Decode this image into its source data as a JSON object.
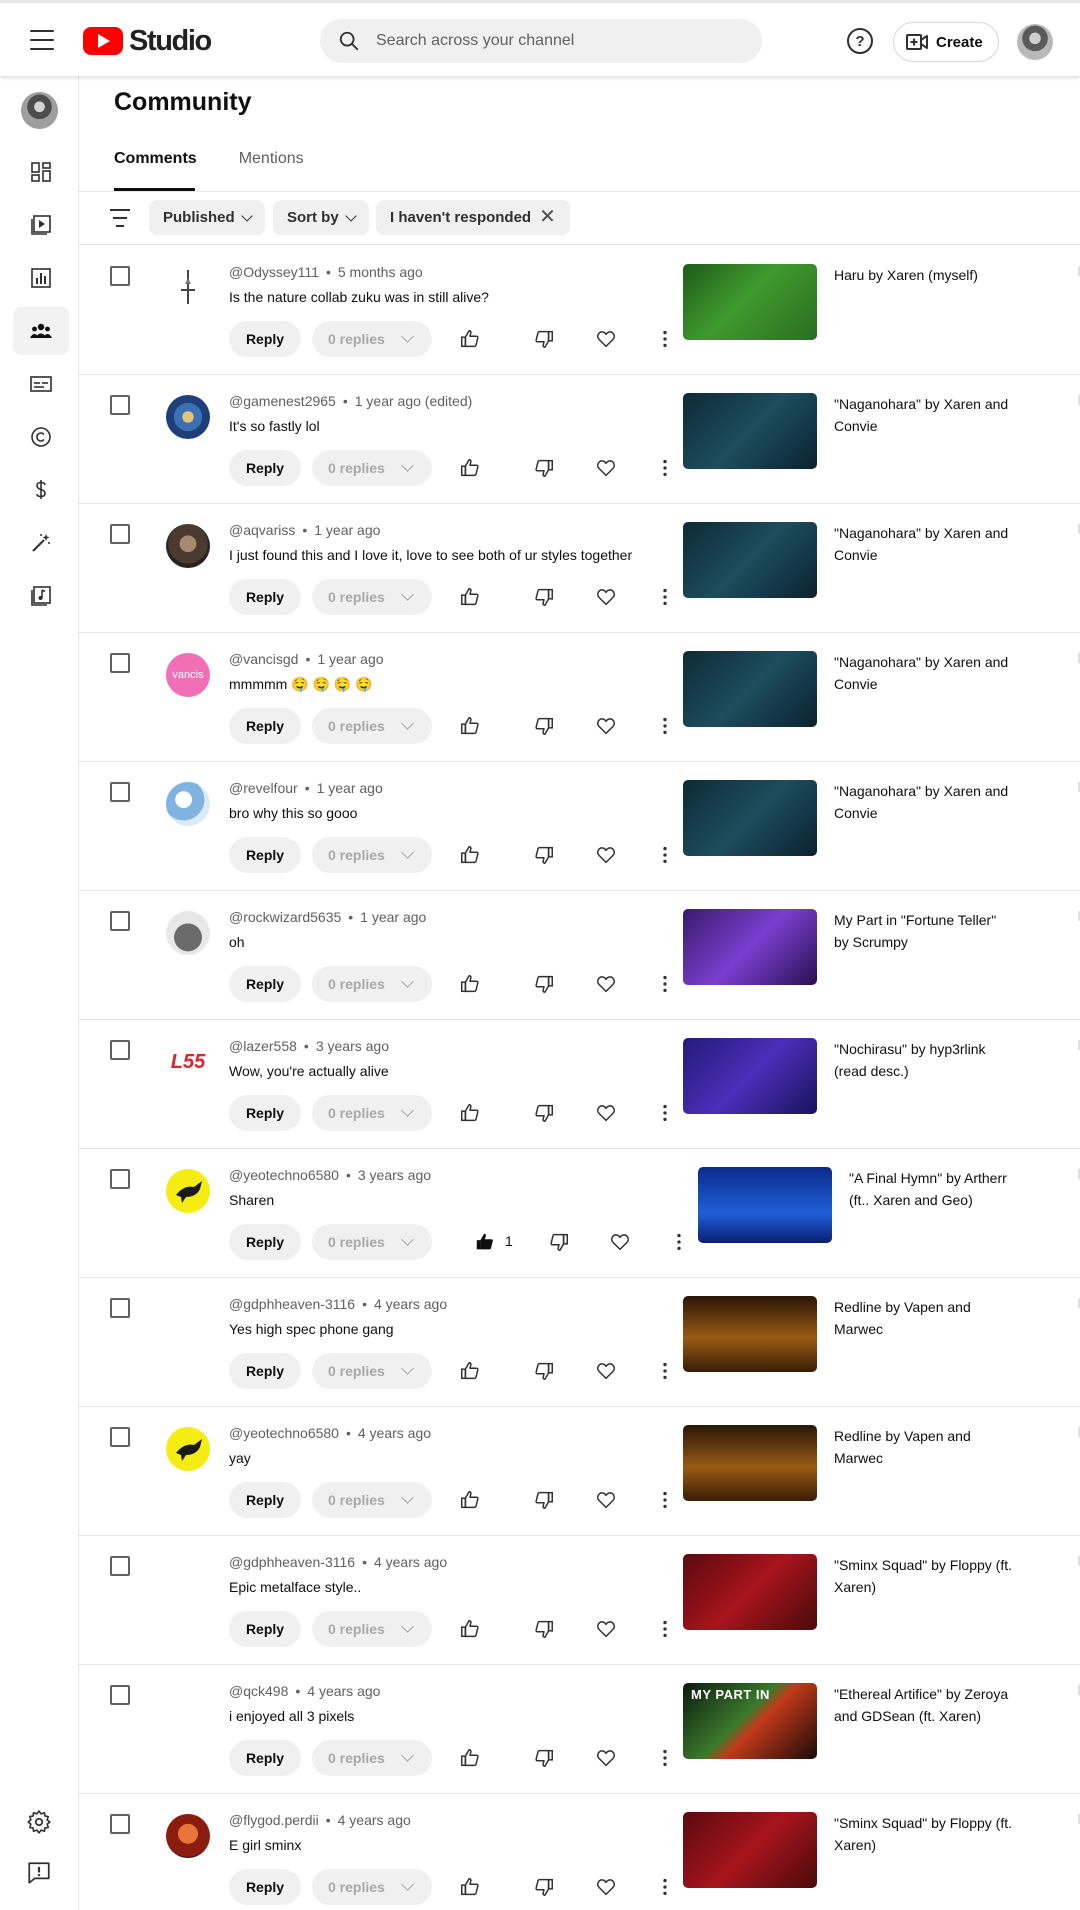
{
  "header": {
    "logo_text": "Studio",
    "search_placeholder": "Search across your channel",
    "help_glyph": "?",
    "create_label": "Create"
  },
  "page": {
    "title": "Community",
    "tabs": [
      {
        "label": "Comments",
        "active": true
      },
      {
        "label": "Mentions",
        "active": false
      }
    ]
  },
  "filters": {
    "chips": [
      {
        "label": "Published"
      },
      {
        "label": "Sort by"
      },
      {
        "label": "I haven't responded"
      }
    ],
    "close_glyph": "✕"
  },
  "labels": {
    "reply": "Reply",
    "replies": "0 replies"
  },
  "comments": [
    {
      "author": "@Odyssey111",
      "time": "5 months ago",
      "text": "Is the nature collab zuku was in still alive?",
      "video": "Haru by Xaren (myself)",
      "likes": "",
      "liked": false,
      "avatar": "sword",
      "thumb": "green"
    },
    {
      "author": "@gamenest2965",
      "time": "1 year ago (edited)",
      "text": "It's so fastly lol",
      "video": "\"Naganohara\" by Xaren and Convie",
      "likes": "",
      "liked": false,
      "avatar": "blue",
      "thumb": "teal"
    },
    {
      "author": "@aqvariss",
      "time": "1 year ago",
      "text": "I just found this and I love it, love to see both of ur styles together",
      "video": "\"Naganohara\" by Xaren and Convie",
      "likes": "",
      "liked": false,
      "avatar": "dark",
      "thumb": "teal"
    },
    {
      "author": "@vancisgd",
      "time": "1 year ago",
      "text": "mmmmm 🤤 🤤 🤤 🤤",
      "video": "\"Naganohara\" by Xaren and Convie",
      "likes": "",
      "liked": false,
      "avatar": "pink",
      "avatar_text": "vancis",
      "thumb": "teal"
    },
    {
      "author": "@revelfour",
      "time": "1 year ago",
      "text": "bro why this so gooo",
      "video": "\"Naganohara\" by Xaren and Convie",
      "likes": "",
      "liked": false,
      "avatar": "sky",
      "thumb": "teal"
    },
    {
      "author": "@rockwizard5635",
      "time": "1 year ago",
      "text": "oh",
      "video": "My Part in \"Fortune Teller\" by Scrumpy",
      "likes": "",
      "liked": false,
      "avatar": "rock",
      "thumb": "purple"
    },
    {
      "author": "@lazer558",
      "time": "3 years ago",
      "text": "Wow, you're actually alive",
      "video": "\"Nochirasu\" by hyp3rlink (read desc.)",
      "likes": "",
      "liked": false,
      "avatar": "l55",
      "avatar_text": "L55",
      "thumb": "violet"
    },
    {
      "author": "@yeotechno6580",
      "time": "3 years ago",
      "text": "Sharen",
      "video": "\"A Final Hymn\" by Artherr (ft.. Xaren and Geo)",
      "likes": "1",
      "liked": true,
      "avatar": "yellow",
      "thumb": "blue",
      "shifted": true
    },
    {
      "author": "@gdphheaven-3116",
      "time": "4 years ago",
      "text": "Yes high spec phone gang",
      "video": "Redline by Vapen and Marwec",
      "likes": "",
      "liked": false,
      "avatar": "none",
      "thumb": "amber"
    },
    {
      "author": "@yeotechno6580",
      "time": "4 years ago",
      "text": "yay",
      "video": "Redline by Vapen and Marwec",
      "likes": "",
      "liked": false,
      "avatar": "yellow",
      "thumb": "amber"
    },
    {
      "author": "@gdphheaven-3116",
      "time": "4 years ago",
      "text": "Epic metalface style..",
      "video": "\"Sminx Squad\" by Floppy (ft. Xaren)",
      "likes": "",
      "liked": false,
      "avatar": "none",
      "thumb": "red"
    },
    {
      "author": "@qck498",
      "time": "4 years ago",
      "text": "i enjoyed all 3 pixels",
      "video": "\"Ethereal Artifice\" by Zeroya and GDSean (ft. Xaren)",
      "likes": "",
      "liked": false,
      "avatar": "none",
      "thumb": "artifice",
      "thumb_text": "MY PART IN"
    },
    {
      "author": "@flygod.perdii",
      "time": "4 years ago",
      "text": "E girl sminx",
      "video": "\"Sminx Squad\" by Floppy (ft. Xaren)",
      "likes": "",
      "liked": false,
      "avatar": "red",
      "thumb": "red"
    }
  ],
  "sidebar_icons": [
    "dashboard-icon",
    "content-icon",
    "analytics-icon",
    "community-icon",
    "subtitles-icon",
    "copyright-icon",
    "earn-icon",
    "customization-icon",
    "audio-library-icon"
  ],
  "sidebar_bottom_icons": [
    "settings-icon",
    "feedback-icon"
  ],
  "colors": {
    "brand_red": "#ff0000",
    "chip_bg": "#f0f0f0",
    "divider": "#e5e5e5",
    "meta_text": "#606060"
  }
}
